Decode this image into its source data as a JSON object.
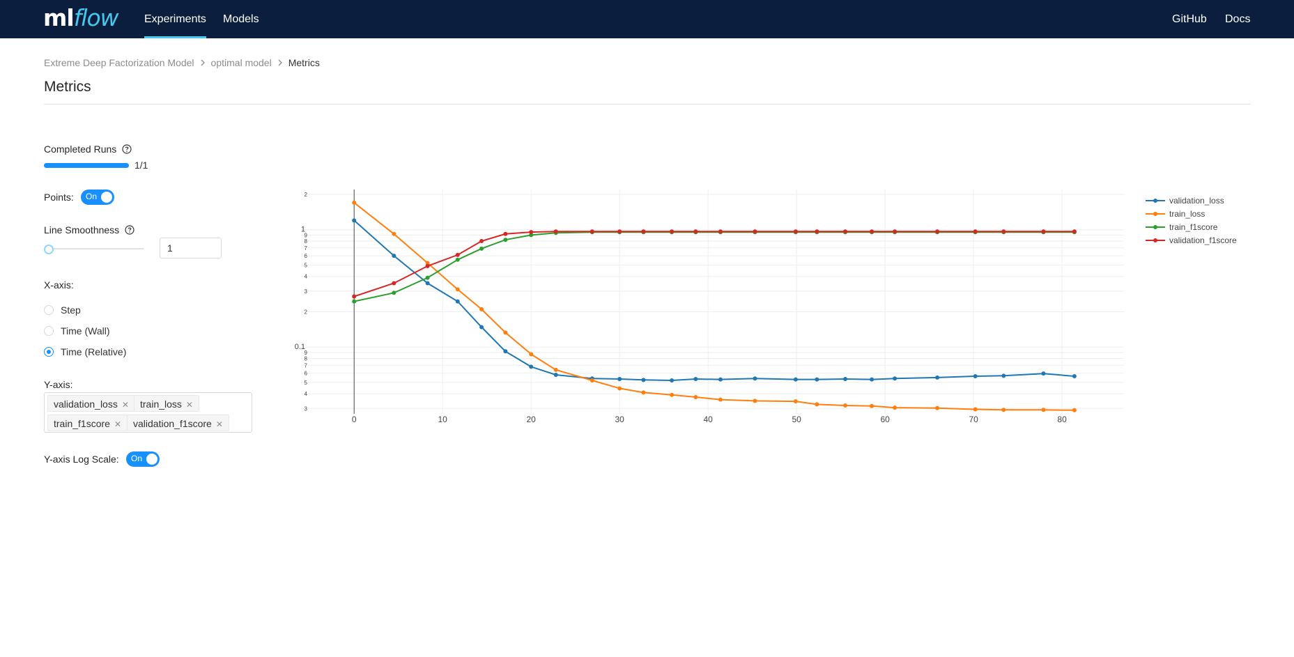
{
  "header": {
    "logo_ml": "ml",
    "logo_flow": "flow",
    "nav": [
      {
        "label": "Experiments",
        "active": true
      },
      {
        "label": "Models",
        "active": false
      }
    ],
    "links": [
      {
        "label": "GitHub"
      },
      {
        "label": "Docs"
      }
    ],
    "background": "#0b1e3d",
    "accent": "#43c9ed"
  },
  "breadcrumb": {
    "items": [
      "Extreme Deep Factorization Model",
      "optimal model",
      "Metrics"
    ]
  },
  "page": {
    "title": "Metrics"
  },
  "controls": {
    "completed_runs": {
      "label": "Completed Runs",
      "progress": 1.0,
      "text": "1/1"
    },
    "points": {
      "label": "Points:",
      "toggle": "On"
    },
    "smoothness": {
      "label": "Line Smoothness",
      "value": "1",
      "slider_fraction": 0.0
    },
    "xaxis": {
      "label": "X-axis:",
      "options": [
        "Step",
        "Time (Wall)",
        "Time (Relative)"
      ],
      "selected": "Time (Relative)"
    },
    "yaxis": {
      "label": "Y-axis:",
      "selected": [
        "validation_loss",
        "train_loss",
        "train_f1score",
        "validation_f1score"
      ]
    },
    "log_scale": {
      "label": "Y-axis Log Scale:",
      "toggle": "On"
    }
  },
  "chart_data": {
    "type": "line",
    "y_scale": "log",
    "xlim": [
      -6,
      87
    ],
    "ylim": [
      0.027,
      2.2
    ],
    "x_ticks": [
      0,
      10,
      20,
      30,
      40,
      50,
      60,
      70,
      80
    ],
    "y_ticks": [
      {
        "value": 2,
        "label": "2"
      },
      {
        "value": 1,
        "label": "1"
      },
      {
        "value": 0.9,
        "label": "9"
      },
      {
        "value": 0.8,
        "label": "8"
      },
      {
        "value": 0.7,
        "label": "7"
      },
      {
        "value": 0.6,
        "label": "6"
      },
      {
        "value": 0.5,
        "label": "5"
      },
      {
        "value": 0.4,
        "label": "4"
      },
      {
        "value": 0.3,
        "label": "3"
      },
      {
        "value": 0.2,
        "label": "2"
      },
      {
        "value": 0.1,
        "label": "0.1"
      },
      {
        "value": 0.09,
        "label": "9"
      },
      {
        "value": 0.08,
        "label": "8"
      },
      {
        "value": 0.07,
        "label": "7"
      },
      {
        "value": 0.06,
        "label": "6"
      },
      {
        "value": 0.05,
        "label": "5"
      },
      {
        "value": 0.04,
        "label": "4"
      },
      {
        "value": 0.03,
        "label": "3"
      }
    ],
    "grid": true,
    "legend_position": "top-right",
    "series": [
      {
        "name": "validation_loss",
        "color": "#1f77b4",
        "x": [
          0,
          4.5,
          8.3,
          11.7,
          14.4,
          17.1,
          20,
          22.8,
          26.9,
          30,
          32.7,
          35.9,
          38.6,
          41.4,
          45.3,
          49.9,
          52.3,
          55.5,
          58.5,
          61.1,
          65.9,
          70.2,
          73.4,
          77.9,
          81.4
        ],
        "values": [
          1.2,
          0.6,
          0.35,
          0.245,
          0.148,
          0.092,
          0.068,
          0.058,
          0.054,
          0.0535,
          0.0525,
          0.052,
          0.0535,
          0.053,
          0.054,
          0.053,
          0.053,
          0.0535,
          0.053,
          0.054,
          0.055,
          0.0565,
          0.057,
          0.0595,
          0.0565
        ]
      },
      {
        "name": "train_loss",
        "color": "#ff7f0e",
        "x": [
          0,
          4.5,
          8.3,
          11.7,
          14.4,
          17.1,
          20,
          22.8,
          26.9,
          30,
          32.7,
          35.9,
          38.6,
          41.4,
          45.3,
          49.9,
          52.3,
          55.5,
          58.5,
          61.1,
          65.9,
          70.2,
          73.4,
          77.9,
          81.4
        ],
        "values": [
          1.7,
          0.92,
          0.52,
          0.31,
          0.21,
          0.133,
          0.087,
          0.064,
          0.052,
          0.0445,
          0.041,
          0.0392,
          0.0375,
          0.0357,
          0.0348,
          0.0345,
          0.0325,
          0.0318,
          0.0315,
          0.0305,
          0.0302,
          0.0295,
          0.0292,
          0.0292,
          0.029
        ]
      },
      {
        "name": "train_f1score",
        "color": "#2ca02c",
        "x": [
          0,
          4.5,
          8.3,
          11.7,
          14.4,
          17.1,
          20,
          22.8,
          26.9,
          30,
          32.7,
          35.9,
          38.6,
          41.4,
          45.3,
          49.9,
          52.3,
          55.5,
          58.5,
          61.1,
          65.9,
          70.2,
          73.4,
          77.9,
          81.4
        ],
        "values": [
          0.245,
          0.29,
          0.39,
          0.555,
          0.69,
          0.82,
          0.9,
          0.94,
          0.952,
          0.952,
          0.952,
          0.952,
          0.952,
          0.952,
          0.952,
          0.952,
          0.952,
          0.952,
          0.952,
          0.952,
          0.952,
          0.952,
          0.952,
          0.952,
          0.952
        ]
      },
      {
        "name": "validation_f1score",
        "color": "#d62728",
        "x": [
          0,
          4.5,
          8.3,
          11.7,
          14.4,
          17.1,
          20,
          22.8,
          26.9,
          30,
          32.7,
          35.9,
          38.6,
          41.4,
          45.3,
          49.9,
          52.3,
          55.5,
          58.5,
          61.1,
          65.9,
          70.2,
          73.4,
          77.9,
          81.4
        ],
        "values": [
          0.27,
          0.35,
          0.49,
          0.61,
          0.8,
          0.92,
          0.955,
          0.965,
          0.965,
          0.965,
          0.965,
          0.965,
          0.965,
          0.965,
          0.965,
          0.965,
          0.965,
          0.965,
          0.965,
          0.965,
          0.965,
          0.965,
          0.965,
          0.965,
          0.965
        ]
      }
    ]
  }
}
